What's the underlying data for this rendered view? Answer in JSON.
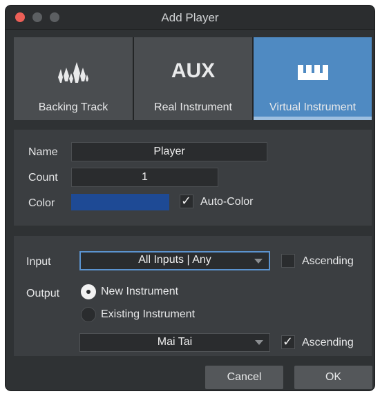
{
  "window": {
    "title": "Add Player"
  },
  "player_types": [
    {
      "label": "Backing Track",
      "icon": "waveform-icon",
      "active": false
    },
    {
      "label": "Real Instrument",
      "icon": "aux-icon",
      "icon_text": "AUX",
      "active": false
    },
    {
      "label": "Virtual Instrument",
      "icon": "keyboard-icon",
      "active": true
    }
  ],
  "settings": {
    "name_label": "Name",
    "name_value": "Player",
    "count_label": "Count",
    "count_value": "1",
    "color_label": "Color",
    "color_value": "#1e4a95",
    "auto_color_label": "Auto-Color",
    "auto_color_checked": true
  },
  "routing": {
    "input_label": "Input",
    "input_value": "All Inputs | Any",
    "input_ascending_label": "Ascending",
    "input_ascending_checked": false,
    "output_label": "Output",
    "new_instrument_label": "New Instrument",
    "existing_instrument_label": "Existing Instrument",
    "selected_output": "New Instrument",
    "instrument_value": "Mai Tai",
    "output_ascending_label": "Ascending",
    "output_ascending_checked": true
  },
  "actions": {
    "cancel_label": "Cancel",
    "ok_label": "OK"
  },
  "colors": {
    "accent": "#4f8ac2",
    "focus": "#5b93cf",
    "close": "#ec5f57",
    "panel": "#3b3e41",
    "background": "#2f3234"
  }
}
